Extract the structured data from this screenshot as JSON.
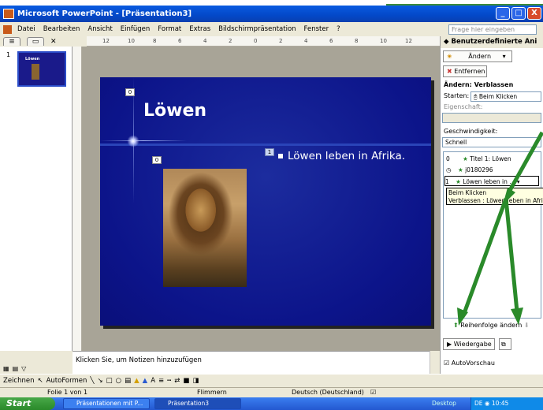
{
  "window": {
    "title": "Microsoft PowerPoint - [Präsentation3]",
    "buttons": [
      "_",
      "□",
      "X"
    ]
  },
  "menu": [
    "Datei",
    "Bearbeiten",
    "Ansicht",
    "Einfügen",
    "Format",
    "Extras",
    "Bildschirmpräsentation",
    "Fenster",
    "?"
  ],
  "help_placeholder": "Frage hier eingeben",
  "ruler": {
    "h_ticks": [
      "12",
      "10",
      "8",
      "6",
      "4",
      "2",
      "0",
      "2",
      "4",
      "6",
      "8",
      "10",
      "12"
    ]
  },
  "thumbnail": {
    "number": "1",
    "title": "Löwen"
  },
  "slide": {
    "title": "Löwen",
    "title_tag": "0",
    "image_tag": "0",
    "bullet_tag": "1",
    "bullet_text": "Löwen leben in Afrika."
  },
  "notes_placeholder": "Klicken Sie, um Notizen hinzuzufügen",
  "drawbar": {
    "zeichnen": "Zeichnen",
    "autoformen": "AutoFormen"
  },
  "status": {
    "slide": "Folie 1 von 1",
    "design": "Flimmern",
    "language": "Deutsch (Deutschland)"
  },
  "taskbar": {
    "start": "Start",
    "tasks": [
      "Präsentationen mit P...",
      "Präsentation3"
    ],
    "tray_text": "Desktop",
    "lang": "DE",
    "time": "10:45"
  },
  "taskpane": {
    "title": "Benutzerdefinierte Ani",
    "change_btn": "Ändern",
    "remove_btn": "Entfernen",
    "section": "Ändern: Verblassen",
    "start_label": "Starten:",
    "start_value": "Beim Klicken",
    "property_label": "Eigenschaft:",
    "speed_label": "Geschwindigkeit:",
    "speed_value": "Schnell",
    "items": [
      {
        "num": "0",
        "text": "Titel 1: Löwen"
      },
      {
        "num": "",
        "text": "j0180296"
      },
      {
        "num": "1",
        "text": "Löwen leben in ..."
      }
    ],
    "tooltip_line1": "Beim Klicken",
    "tooltip_line2": "Verblassen : Löwen leben in Afrika",
    "reorder": "Reihenfolge ändern",
    "play_btn": "Wiedergabe",
    "autopreview": "AutoVorschau"
  },
  "colors": {
    "slide_bg": "#0c148a",
    "arrow": "#2a8a2a"
  }
}
